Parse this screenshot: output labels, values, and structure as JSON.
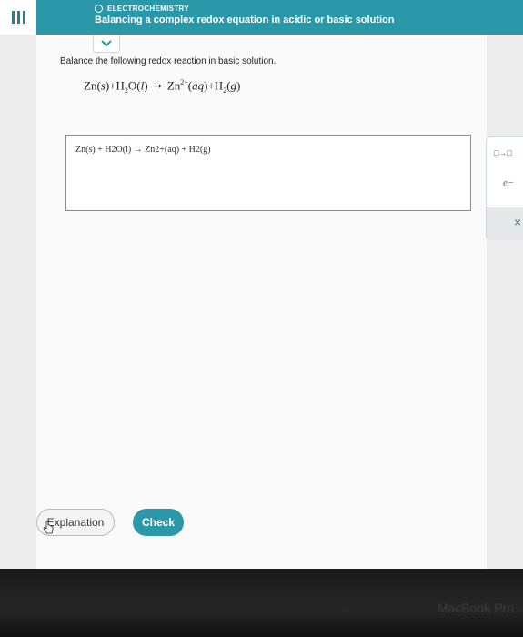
{
  "header": {
    "topic": "ELECTROCHEMISTRY",
    "title": "Balancing a complex redox equation in acidic or basic solution"
  },
  "question": {
    "prompt": "Balance the following redox reaction in basic solution."
  },
  "answer": {
    "equation_template": "Zn(s) + H2O(l) → Zn2+(aq) + H2(g)"
  },
  "tools": {
    "reaction_arrow_icon": "□→□",
    "electron_symbol": "e−",
    "close_symbol": "×"
  },
  "actions": {
    "explanation_label": "Explanation",
    "check_label": "Check"
  },
  "device": {
    "laptop_name": "MacBook Pro"
  },
  "colors": {
    "brand": "#2a98a8"
  }
}
